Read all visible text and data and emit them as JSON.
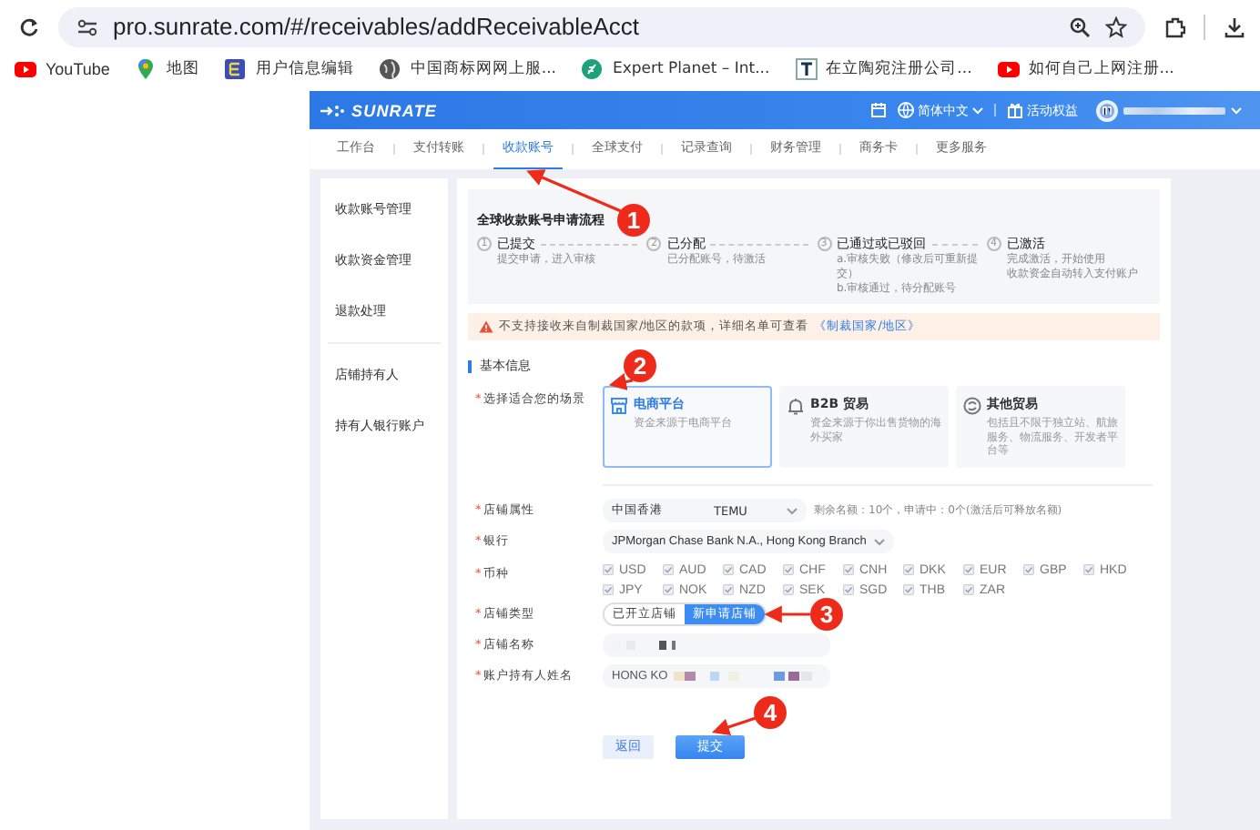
{
  "browser": {
    "url": "pro.sunrate.com/#/receivables/addReceivableAcct",
    "bookmarks": [
      {
        "label": "YouTube",
        "kind": "youtube"
      },
      {
        "label": "地图",
        "kind": "maps"
      },
      {
        "label": "用户信息编辑",
        "kind": "app"
      },
      {
        "label": "中国商标网网上服...",
        "kind": "globe"
      },
      {
        "label": "Expert Planet – Int...",
        "kind": "leaf"
      },
      {
        "label": "在立陶宛注册公司...",
        "kind": "doc"
      },
      {
        "label": "如何自己上网注册...",
        "kind": "youtube"
      }
    ]
  },
  "header": {
    "logo": "SUNRATE",
    "language": "简体中文",
    "promo": "活动权益"
  },
  "nav": [
    {
      "label": "工作台",
      "selected": false
    },
    {
      "label": "支付转账",
      "selected": false
    },
    {
      "label": "收款账号",
      "selected": true
    },
    {
      "label": "全球支付",
      "selected": false
    },
    {
      "label": "记录查询",
      "selected": false
    },
    {
      "label": "财务管理",
      "selected": false
    },
    {
      "label": "商务卡",
      "selected": false
    },
    {
      "label": "更多服务",
      "selected": false
    }
  ],
  "sidebar": {
    "groups": [
      [
        {
          "label": "收款账号管理"
        },
        {
          "label": "收款资金管理"
        },
        {
          "label": "退款处理"
        }
      ],
      [
        {
          "label": "店铺持有人"
        },
        {
          "label": "持有人银行账户"
        }
      ]
    ]
  },
  "process": {
    "title": "全球收款账号申请流程",
    "steps": [
      {
        "number": "1",
        "title": "已提交",
        "lines": [
          "提交申请，进入审核"
        ]
      },
      {
        "number": "2",
        "title": "已分配",
        "lines": [
          "已分配账号，待激活"
        ]
      },
      {
        "number": "3",
        "title": "已通过或已驳回",
        "lines": [
          "a.审核失败（修改后可重新提交）",
          "b.审核通过，待分配账号"
        ]
      },
      {
        "number": "4",
        "title": "已激活",
        "lines": [
          "完成激活，开始使用",
          "收款资金自动转入支付账户"
        ]
      }
    ]
  },
  "warning": {
    "text": "不支持接收来自制裁国家/地区的款项，详细名单可查看",
    "link": "《制裁国家/地区》"
  },
  "section_title": "基本信息",
  "scenario": {
    "label": "选择适合您的场景",
    "required_mark": "*",
    "options": [
      {
        "kind": "shop",
        "title": "电商平台",
        "desc": "资金来源于电商平台",
        "selected": true
      },
      {
        "kind": "bell",
        "title": "B2B 贸易",
        "desc": "资金来源于你出售货物的海外买家",
        "selected": false
      },
      {
        "kind": "other",
        "title": "其他贸易",
        "desc": "包括且不限于独立站、航旅服务、物流服务、开发者平台等",
        "selected": false
      }
    ]
  },
  "form": {
    "store_attr": {
      "label": "店铺属性",
      "required_mark": "*",
      "region": "中国香港",
      "platform": "TEMU",
      "note": "剩余名额：10个，申请中：0个(激活后可释放名额)"
    },
    "bank": {
      "label": "银行",
      "required_mark": "*",
      "value": "JPMorgan Chase Bank N.A., Hong Kong Branch"
    },
    "currency": {
      "label": "币种",
      "required_mark": "*",
      "rows": [
        [
          {
            "code": "USD",
            "checked": true
          },
          {
            "code": "AUD",
            "checked": true
          },
          {
            "code": "CAD",
            "checked": true
          },
          {
            "code": "CHF",
            "checked": true
          },
          {
            "code": "CNH",
            "checked": true
          },
          {
            "code": "DKK",
            "checked": true
          },
          {
            "code": "EUR",
            "checked": true
          },
          {
            "code": "GBP",
            "checked": true
          },
          {
            "code": "HKD",
            "checked": true
          }
        ],
        [
          {
            "code": "JPY",
            "checked": true
          },
          {
            "code": "NOK",
            "checked": true
          },
          {
            "code": "NZD",
            "checked": true
          },
          {
            "code": "SEK",
            "checked": true
          },
          {
            "code": "SGD",
            "checked": true
          },
          {
            "code": "THB",
            "checked": true
          },
          {
            "code": "ZAR",
            "checked": true
          }
        ]
      ]
    },
    "store_type": {
      "label": "店铺类型",
      "required_mark": "*",
      "options": [
        {
          "label": "已开立店铺",
          "selected": false
        },
        {
          "label": "新申请店铺",
          "selected": true
        }
      ]
    },
    "store_name": {
      "label": "店铺名称",
      "required_mark": "*"
    },
    "holder": {
      "label": "账户持有人姓名",
      "required_mark": "*",
      "value": "HONG KO"
    }
  },
  "buttons": [
    {
      "label": "返回",
      "kind": "secondary"
    },
    {
      "label": "提交",
      "kind": "primary"
    }
  ],
  "annotations": [
    {
      "label": "1"
    },
    {
      "label": "2"
    },
    {
      "label": "3"
    },
    {
      "label": "4"
    }
  ]
}
